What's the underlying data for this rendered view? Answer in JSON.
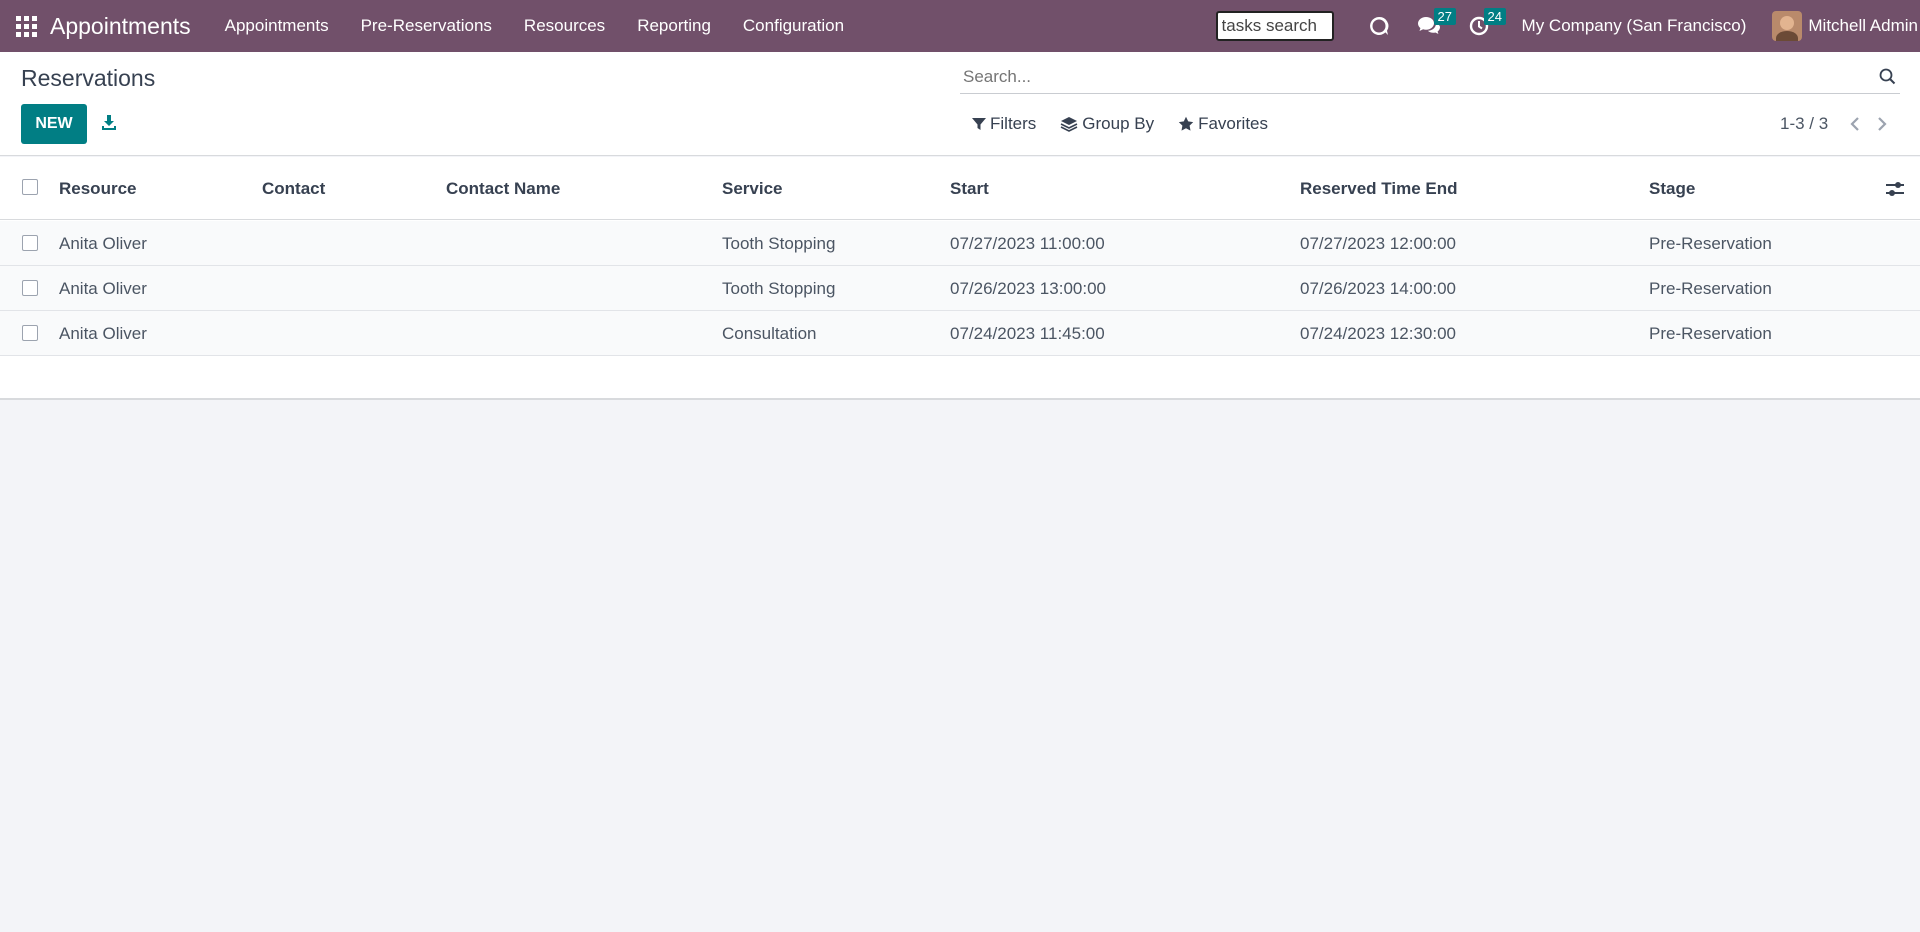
{
  "navbar": {
    "app_name": "Appointments",
    "menu": [
      "Appointments",
      "Pre-Reservations",
      "Resources",
      "Reporting",
      "Configuration"
    ],
    "tasks_search_value": "tasks search",
    "messages_count": "27",
    "activities_count": "24",
    "company": "My Company (San Francisco)",
    "user": "Mitchell Admin"
  },
  "control": {
    "title": "Reservations",
    "new_label": "NEW",
    "search_placeholder": "Search...",
    "filters_label": "Filters",
    "group_by_label": "Group By",
    "favorites_label": "Favorites",
    "pager": "1-3 / 3"
  },
  "table": {
    "columns": [
      "Resource",
      "Contact",
      "Contact Name",
      "Service",
      "Start",
      "Reserved Time End",
      "Stage"
    ],
    "rows": [
      {
        "resource": "Anita Oliver",
        "contact": "",
        "contact_name": "",
        "service": "Tooth Stopping",
        "start": "07/27/2023 11:00:00",
        "end": "07/27/2023 12:00:00",
        "stage": "Pre-Reservation"
      },
      {
        "resource": "Anita Oliver",
        "contact": "",
        "contact_name": "",
        "service": "Tooth Stopping",
        "start": "07/26/2023 13:00:00",
        "end": "07/26/2023 14:00:00",
        "stage": "Pre-Reservation"
      },
      {
        "resource": "Anita Oliver",
        "contact": "",
        "contact_name": "",
        "service": "Consultation",
        "start": "07/24/2023 11:45:00",
        "end": "07/24/2023 12:30:00",
        "stage": "Pre-Reservation"
      }
    ]
  },
  "colors": {
    "navbar": "#71506a",
    "primary": "#017e84",
    "background": "#f3f4f8"
  }
}
